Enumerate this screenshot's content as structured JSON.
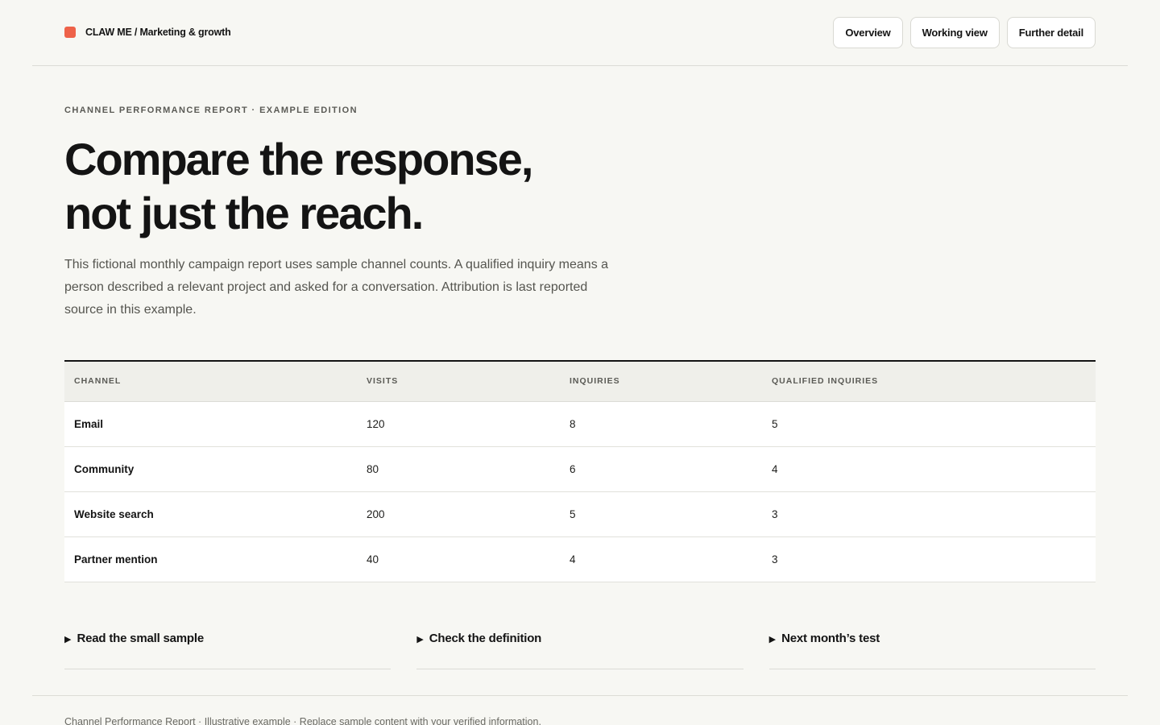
{
  "header": {
    "brand": "CLAW ME / Marketing & growth",
    "brand_color": "#ee6249",
    "nav": [
      "Overview",
      "Working view",
      "Further detail"
    ]
  },
  "hero": {
    "eyebrow": "CHANNEL PERFORMANCE REPORT · EXAMPLE EDITION",
    "headline_line1": "Compare the response,",
    "headline_line2": "not just the reach.",
    "lede": "This fictional monthly campaign report uses sample channel counts. A qualified inquiry means a person described a relevant project and asked for a conversation. Attribution is last reported source in this example."
  },
  "table": {
    "columns": [
      "CHANNEL",
      "VISITS",
      "INQUIRIES",
      "QUALIFIED INQUIRIES"
    ],
    "rows": [
      [
        "Email",
        "120",
        "8",
        "5"
      ],
      [
        "Community",
        "80",
        "6",
        "4"
      ],
      [
        "Website search",
        "200",
        "5",
        "3"
      ],
      [
        "Partner mention",
        "40",
        "4",
        "3"
      ]
    ]
  },
  "details": [
    {
      "label": "Read the small sample",
      "icon": "disclosure-triangle-icon"
    },
    {
      "label": "Check the definition",
      "icon": "disclosure-triangle-icon"
    },
    {
      "label": "Next month’s test",
      "icon": "disclosure-triangle-icon"
    }
  ],
  "footer": {
    "text": "Channel Performance Report · Illustrative example · Replace sample content with your verified information."
  }
}
